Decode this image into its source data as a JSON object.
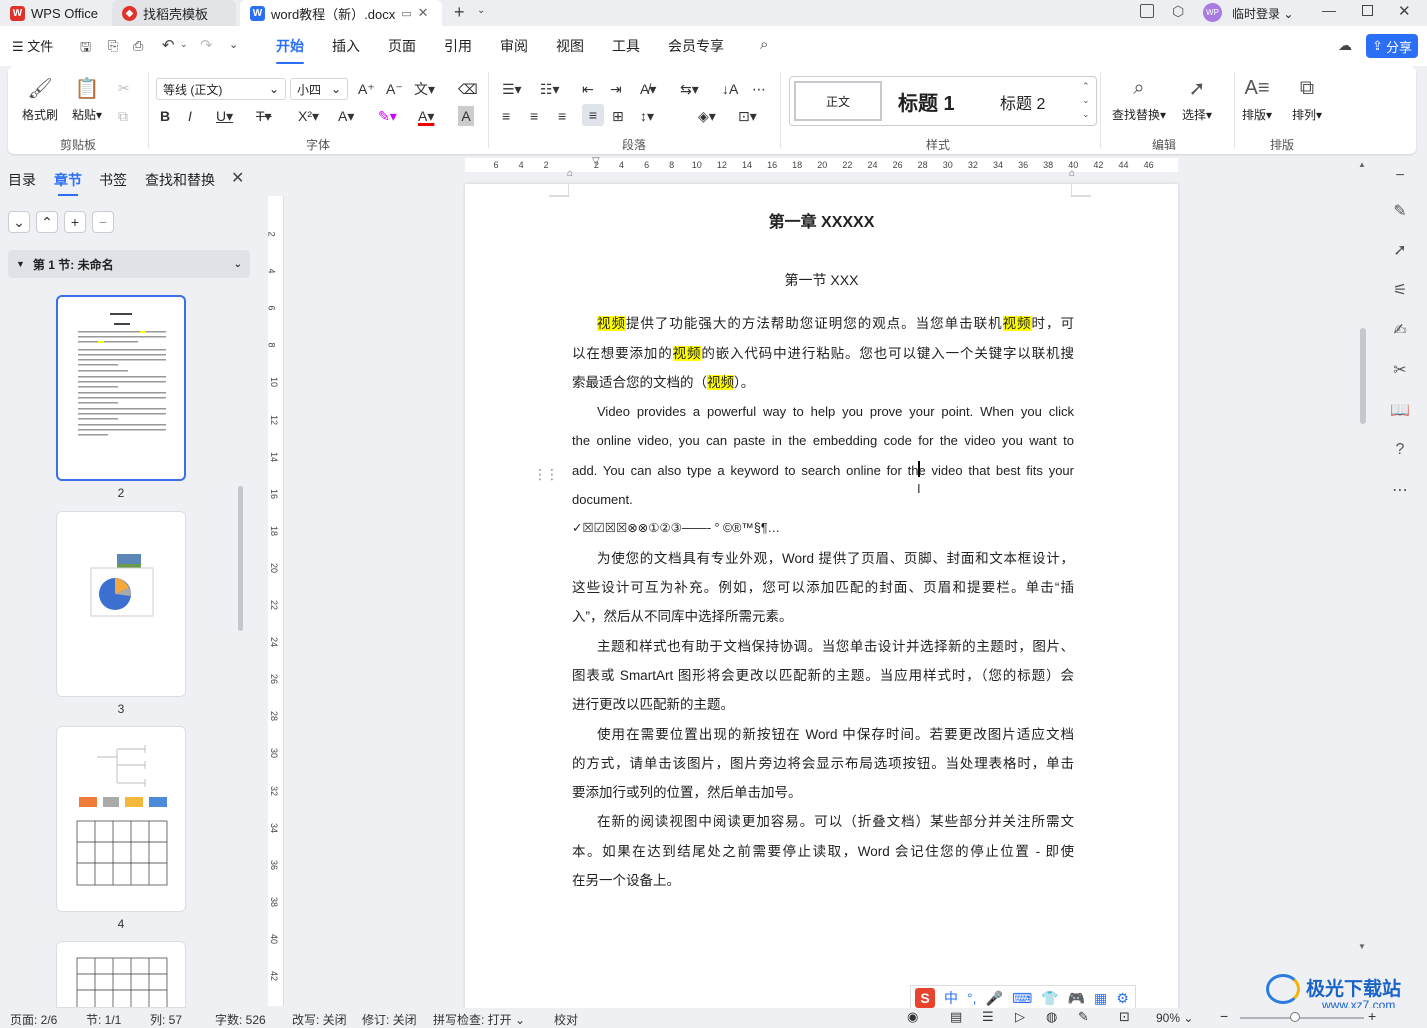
{
  "titlebar": {
    "tabs": [
      {
        "label": "WPS Office"
      },
      {
        "label": "找稻壳模板"
      },
      {
        "label": "word教程（新）.docx"
      }
    ],
    "user": "临时登录",
    "avatar": "WP"
  },
  "menubar": {
    "file": "文件",
    "items": [
      "开始",
      "插入",
      "页面",
      "引用",
      "审阅",
      "视图",
      "工具",
      "会员专享"
    ],
    "active": "开始",
    "share": "分享"
  },
  "ribbon": {
    "clipboard": {
      "format_painter": "格式刷",
      "paste": "粘贴",
      "label": "剪贴板"
    },
    "font": {
      "family": "等线 (正文)",
      "size": "小四",
      "label": "字体"
    },
    "paragraph": {
      "label": "段落"
    },
    "styles": {
      "normal": "正文",
      "h1": "标题 1",
      "h2": "标题 2",
      "label": "样式"
    },
    "edit": {
      "find_replace": "查找替换",
      "select": "选择",
      "label": "编辑"
    },
    "layout": {
      "arrange": "排版",
      "order": "排列",
      "label": "排版"
    }
  },
  "leftpanel": {
    "tabs": [
      "目录",
      "章节",
      "书签",
      "查找和替换"
    ],
    "active_tab": "章节",
    "section_label": "第 1 节: 未命名",
    "page_numbers": [
      "2",
      "3",
      "4"
    ]
  },
  "ruler": {
    "h_ticks": [
      "6",
      "4",
      "2",
      "",
      "2",
      "4",
      "6",
      "8",
      "10",
      "12",
      "14",
      "16",
      "18",
      "20",
      "22",
      "24",
      "26",
      "28",
      "30",
      "32",
      "34",
      "36",
      "38",
      "40",
      "42",
      "44",
      "46"
    ],
    "v_ticks": [
      "2",
      "4",
      "6",
      "8",
      "10",
      "12",
      "14",
      "16",
      "18",
      "20",
      "22",
      "24",
      "26",
      "28",
      "30",
      "32",
      "34",
      "36",
      "38",
      "40",
      "42"
    ]
  },
  "document": {
    "chapter_title": "第一章  XXXXX",
    "section_title": "第一节  XXX",
    "p1_lines": [
      [
        "视频",
        "提供了功能强大的方法帮助您证明您的观点。当您单击联机",
        "视频",
        "时，可"
      ],
      [
        "以在想要添加的",
        "视频",
        "的嵌入代码中进行粘贴。您也可以键入一个关键字以联机搜"
      ],
      [
        "索最适合您的文档的（",
        "视频",
        "）。"
      ]
    ],
    "p2_lines": [
      "Video provides a powerful way to help you prove your point. When you click",
      "the online video, you can paste in the embedding code for the video you want to",
      "add. You can also type a keyword to search online for the video that best fits your",
      "document."
    ],
    "symbols": "✓☒☑☒☒⊗⊗①②③——-  °  ©®™§¶…",
    "p3_lines": [
      "为使您的文档具有专业外观，Word 提供了页眉、页脚、封面和文本框设计，",
      "这些设计可互为补充。例如，您可以添加匹配的封面、页眉和提要栏。单击“插",
      "入”，然后从不同库中选择所需元素。"
    ],
    "p4_lines": [
      "主题和样式也有助于文档保持协调。当您单击设计并选择新的主题时，图片、",
      "图表或 SmartArt 图形将会更改以匹配新的主题。当应用样式时，（您的标题）会",
      "进行更改以匹配新的主题。"
    ],
    "p5_lines": [
      "使用在需要位置出现的新按钮在 Word 中保存时间。若要更改图片适应文档",
      "的方式，请单击该图片，图片旁边将会显示布局选项按钮。当处理表格时，单击",
      "要添加行或列的位置，然后单击加号。"
    ],
    "p6_lines": [
      "在新的阅读视图中阅读更加容易。可以（折叠文档）某些部分并关注所需文",
      "本。如果在达到结尾处之前需要停止读取，Word 会记住您的停止位置 - 即使",
      "在另一个设备上。"
    ]
  },
  "ime": {
    "lang": "中"
  },
  "watermark": {
    "site": "极光下载站",
    "url": "www.xz7.com"
  },
  "statusbar": {
    "page": "页面: 2/6",
    "section": "节: 1/1",
    "column": "列: 57",
    "words": "字数: 526",
    "overwrite": "改写: 关闭",
    "revise": "修订: 关闭",
    "spell": "拼写检查: 打开",
    "proof": "校对",
    "zoom": "90%"
  },
  "colors": {
    "accent": "#2a6ff5",
    "highlight": "#ffff00",
    "wps_red": "#e0322b"
  }
}
